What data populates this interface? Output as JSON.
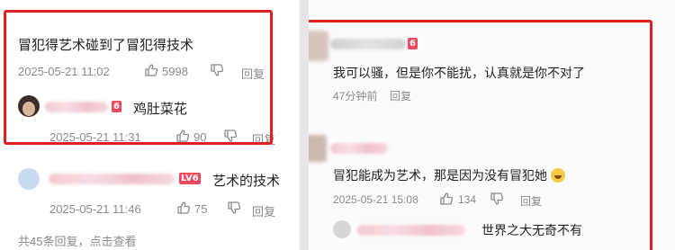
{
  "left": {
    "comment1": {
      "text": "冒犯得艺术碰到了冒犯得技术",
      "timestamp": "2025-05-21 11:02",
      "likes": "5998",
      "reply_label": "回复"
    },
    "reply1": {
      "text": "鸡肚菜花",
      "level_badge": "6",
      "timestamp": "2025-05-21 11:31",
      "likes": "90",
      "reply_label": "回复"
    },
    "comment2": {
      "level_badge": "LV6",
      "text": "艺术的技术",
      "timestamp": "2025-05-21 11:46",
      "likes": "75",
      "reply_label": "回复"
    },
    "footer": "共45条回复，点击查看"
  },
  "right": {
    "comment1": {
      "level_badge": "6",
      "text": "我可以骚，但是你不能扰，认真就是你不对了",
      "timestamp": "47分钟前",
      "reply_label": "回复"
    },
    "comment2": {
      "text": "冒犯能成为艺术，那是因为没有冒犯她",
      "timestamp": "2025-05-21 15:08",
      "likes": "134",
      "reply_label": "回复"
    },
    "reply1": {
      "text": "世界之大无奇不有"
    }
  },
  "colors": {
    "highlight_box": "#e02020",
    "level_badge": "#f0485d",
    "meta_text": "#8a8a8a"
  }
}
